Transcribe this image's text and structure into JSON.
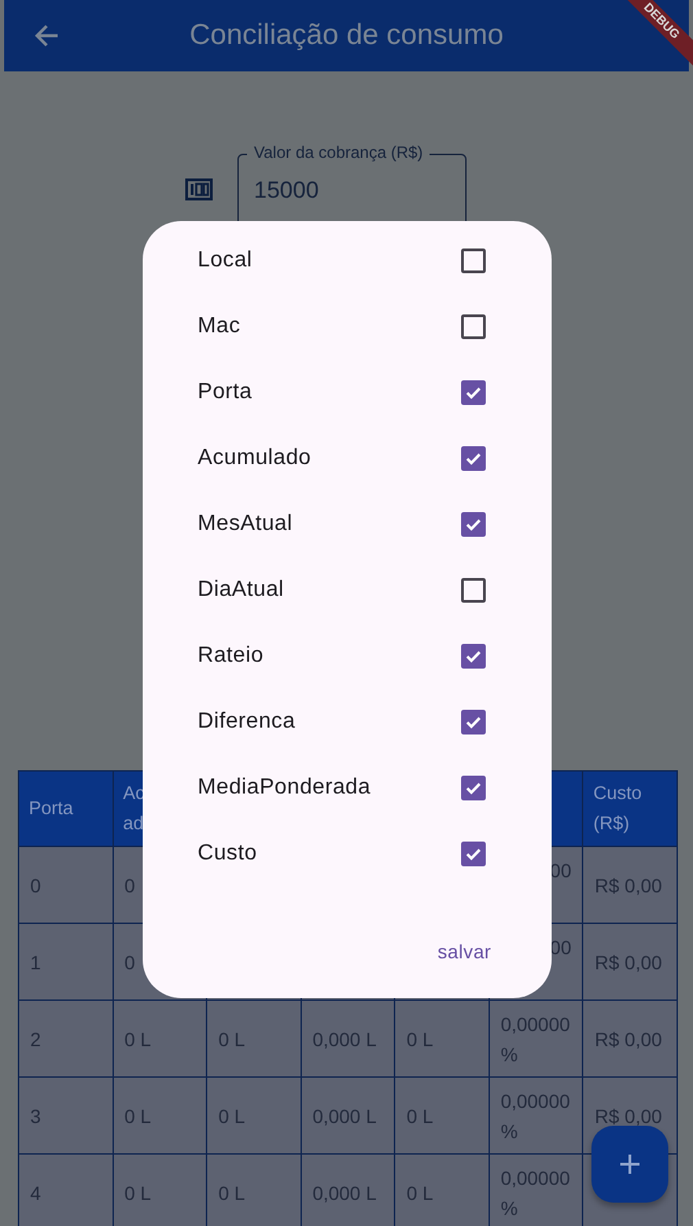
{
  "app_bar": {
    "title": "Conciliação de consumo",
    "debug_banner": "DEBUG"
  },
  "charge_field": {
    "label": "Valor da cobrança (R$)",
    "value": "15000"
  },
  "table": {
    "columns": [
      {
        "text": "Porta"
      },
      {
        "text": "Ac\nad"
      },
      null,
      null,
      null,
      null,
      {
        "text": "Custo\n(R$)"
      }
    ],
    "rows": [
      [
        {
          "text": "0"
        },
        {
          "text": "0"
        },
        null,
        null,
        null,
        {
          "text": "00",
          "cut_left": true
        },
        {
          "text": "R$ 0,00"
        }
      ],
      [
        {
          "text": "1"
        },
        {
          "text": "0"
        },
        null,
        null,
        null,
        {
          "text": "00",
          "cut_left": true
        },
        {
          "text": "R$ 0,00"
        }
      ],
      [
        {
          "text": "2"
        },
        {
          "text": "0 L"
        },
        {
          "text": "0 L"
        },
        {
          "text": "0,000 L"
        },
        {
          "text": "0 L"
        },
        {
          "text": "0,00000\n%"
        },
        {
          "text": "R$ 0,00"
        }
      ],
      [
        {
          "text": "3"
        },
        {
          "text": "0 L"
        },
        {
          "text": "0 L"
        },
        {
          "text": "0,000 L"
        },
        {
          "text": "0 L"
        },
        {
          "text": "0,00000\n%"
        },
        {
          "text": "R$ 0,00"
        }
      ],
      [
        {
          "text": "4"
        },
        {
          "text": "0 L"
        },
        {
          "text": "0 L"
        },
        {
          "text": "0,000 L"
        },
        {
          "text": "0 L"
        },
        {
          "text": "0,00000\n%"
        },
        null
      ]
    ]
  },
  "dialog": {
    "options": [
      {
        "label": "Local",
        "checked": false
      },
      {
        "label": "Mac",
        "checked": false
      },
      {
        "label": "Porta",
        "checked": true
      },
      {
        "label": "Acumulado",
        "checked": true
      },
      {
        "label": "MesAtual",
        "checked": true
      },
      {
        "label": "DiaAtual",
        "checked": false
      },
      {
        "label": "Rateio",
        "checked": true
      },
      {
        "label": "Diferenca",
        "checked": true
      },
      {
        "label": "MediaPonderada",
        "checked": true
      },
      {
        "label": "Custo",
        "checked": true
      }
    ],
    "save_button": "salvar"
  }
}
